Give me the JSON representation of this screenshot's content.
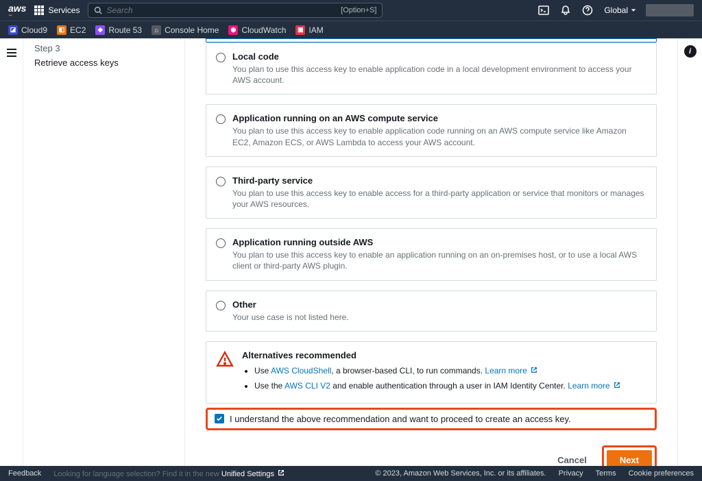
{
  "topbar": {
    "logo": "aws",
    "services_label": "Services",
    "search_placeholder": "Search",
    "search_shortcut": "[Option+S]",
    "region_label": "Global"
  },
  "favorites": [
    {
      "label": "Cloud9",
      "badge_class": "fav-cloud9",
      "char": "◪"
    },
    {
      "label": "EC2",
      "badge_class": "fav-ec2",
      "char": "◧"
    },
    {
      "label": "Route 53",
      "badge_class": "fav-r53",
      "char": "◆"
    },
    {
      "label": "Console Home",
      "badge_class": "fav-console",
      "char": "⌂"
    },
    {
      "label": "CloudWatch",
      "badge_class": "fav-cw",
      "char": "◉"
    },
    {
      "label": "IAM",
      "badge_class": "fav-iam",
      "char": "▣"
    }
  ],
  "sidebar": {
    "step_label": "Step 3",
    "link_label": "Retrieve access keys"
  },
  "options": [
    {
      "title": "Local code",
      "desc": "You plan to use this access key to enable application code in a local development environment to access your AWS account."
    },
    {
      "title": "Application running on an AWS compute service",
      "desc": "You plan to use this access key to enable application code running on an AWS compute service like Amazon EC2, Amazon ECS, or AWS Lambda to access your AWS account."
    },
    {
      "title": "Third-party service",
      "desc": "You plan to use this access key to enable access for a third-party application or service that monitors or manages your AWS resources."
    },
    {
      "title": "Application running outside AWS",
      "desc": "You plan to use this access key to enable an application running on an on-premises host, or to use a local AWS client or third-party AWS plugin."
    },
    {
      "title": "Other",
      "desc": "Your use case is not listed here."
    }
  ],
  "alternatives": {
    "title": "Alternatives recommended",
    "item1_prefix": "Use ",
    "item1_link": "AWS CloudShell",
    "item1_suffix": ", a browser-based CLI, to run commands. ",
    "item1_learn": "Learn more",
    "item2_prefix": "Use the ",
    "item2_link": "AWS CLI V2",
    "item2_suffix": " and enable authentication through a user in IAM Identity Center. ",
    "item2_learn": "Learn more"
  },
  "confirm_label": "I understand the above recommendation and want to proceed to create an access key.",
  "actions": {
    "cancel": "Cancel",
    "next": "Next"
  },
  "footer": {
    "feedback": "Feedback",
    "lang_prefix": "Looking for language selection? Find it in the new ",
    "lang_link": "Unified Settings",
    "copyright": "© 2023, Amazon Web Services, Inc. or its affiliates.",
    "privacy": "Privacy",
    "terms": "Terms",
    "cookies": "Cookie preferences"
  }
}
